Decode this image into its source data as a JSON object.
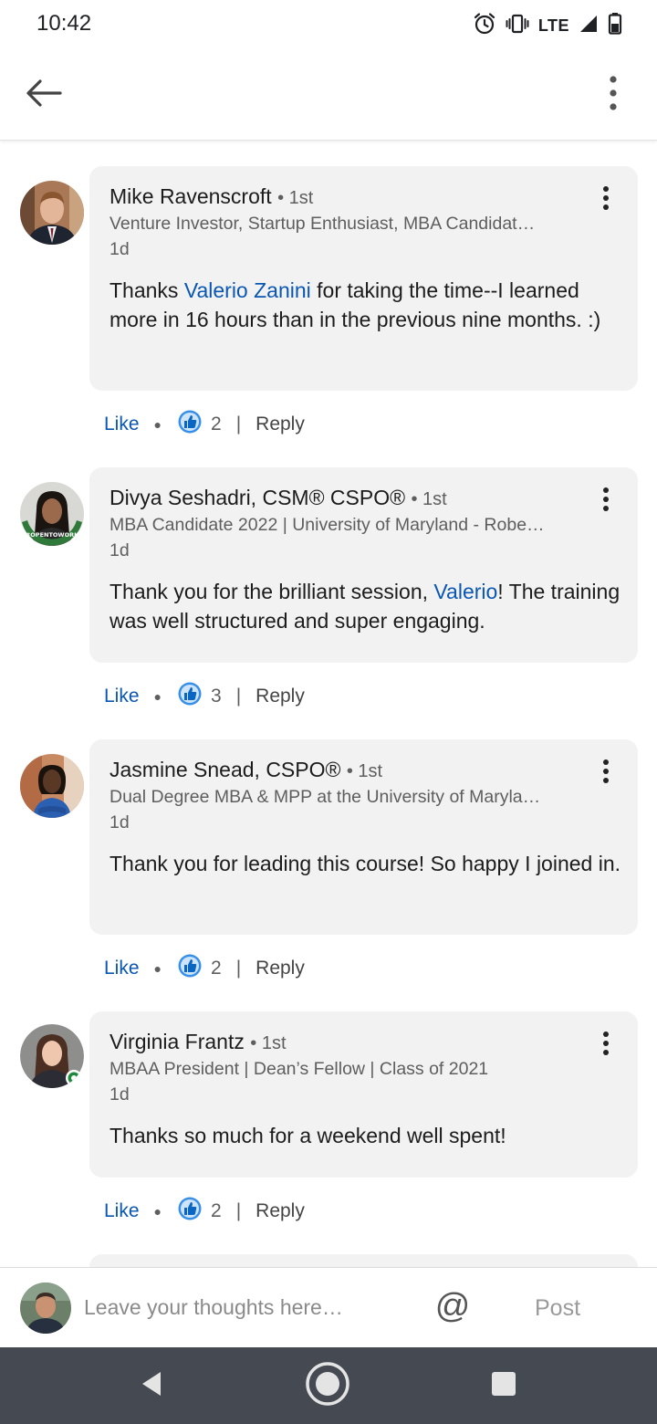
{
  "status_bar": {
    "time": "10:42",
    "network": "LTE",
    "icons": [
      "alarm-icon",
      "vibrate-icon",
      "signal-icon",
      "battery-icon"
    ]
  },
  "app_bar": {
    "icons": [
      "back-arrow-icon",
      "overflow-menu-icon"
    ]
  },
  "colors": {
    "link_blue": "#0a56b3",
    "bubble_bg": "#f2f2f2",
    "nav_bar": "#454a52",
    "online_green": "#1f8a3a"
  },
  "comments": [
    {
      "name": "Mike Ravenscroft",
      "degree": "• 1st",
      "headline": "Venture Investor, Startup Enthusiast, MBA Candidat…",
      "time": "1d",
      "body_before": "Thanks ",
      "mention": "Valerio Zanini",
      "body_after": " for taking the time--I learned more in 16 hours than in the previous nine months. :)",
      "like_label": "Like",
      "reaction_count": "2",
      "reply_label": "Reply"
    },
    {
      "name": "Divya Seshadri, CSM® CSPO®",
      "degree": "• 1st",
      "headline": "MBA Candidate 2022 | University of Maryland - Robe…",
      "time": "1d",
      "body_before": "Thank you for the brilliant session, ",
      "mention": "Valerio",
      "body_after": "! The training was well structured and super engaging.",
      "avatar_ring_text": "#OPENTOWORK",
      "like_label": "Like",
      "reaction_count": "3",
      "reply_label": "Reply"
    },
    {
      "name": "Jasmine Snead, CSPO®",
      "degree": "• 1st",
      "headline": "Dual Degree MBA & MPP at the University of Maryla…",
      "time": "1d",
      "body_before": "Thank you for leading this course! So happy I joined in.",
      "mention": "",
      "body_after": "",
      "like_label": "Like",
      "reaction_count": "2",
      "reply_label": "Reply"
    },
    {
      "name": "Virginia Frantz",
      "degree": "• 1st",
      "headline": "MBAA President | Dean’s Fellow | Class of 2021",
      "time": "1d",
      "body_before": "Thanks so much for a weekend well spent!",
      "mention": "",
      "body_after": "",
      "like_label": "Like",
      "reaction_count": "2",
      "reply_label": "Reply"
    }
  ],
  "composer": {
    "placeholder": "Leave your thoughts here…",
    "mention_symbol": "@",
    "post_label": "Post"
  },
  "nav_bar": {
    "icons": [
      "nav-back-icon",
      "nav-home-icon",
      "nav-recents-icon"
    ]
  }
}
